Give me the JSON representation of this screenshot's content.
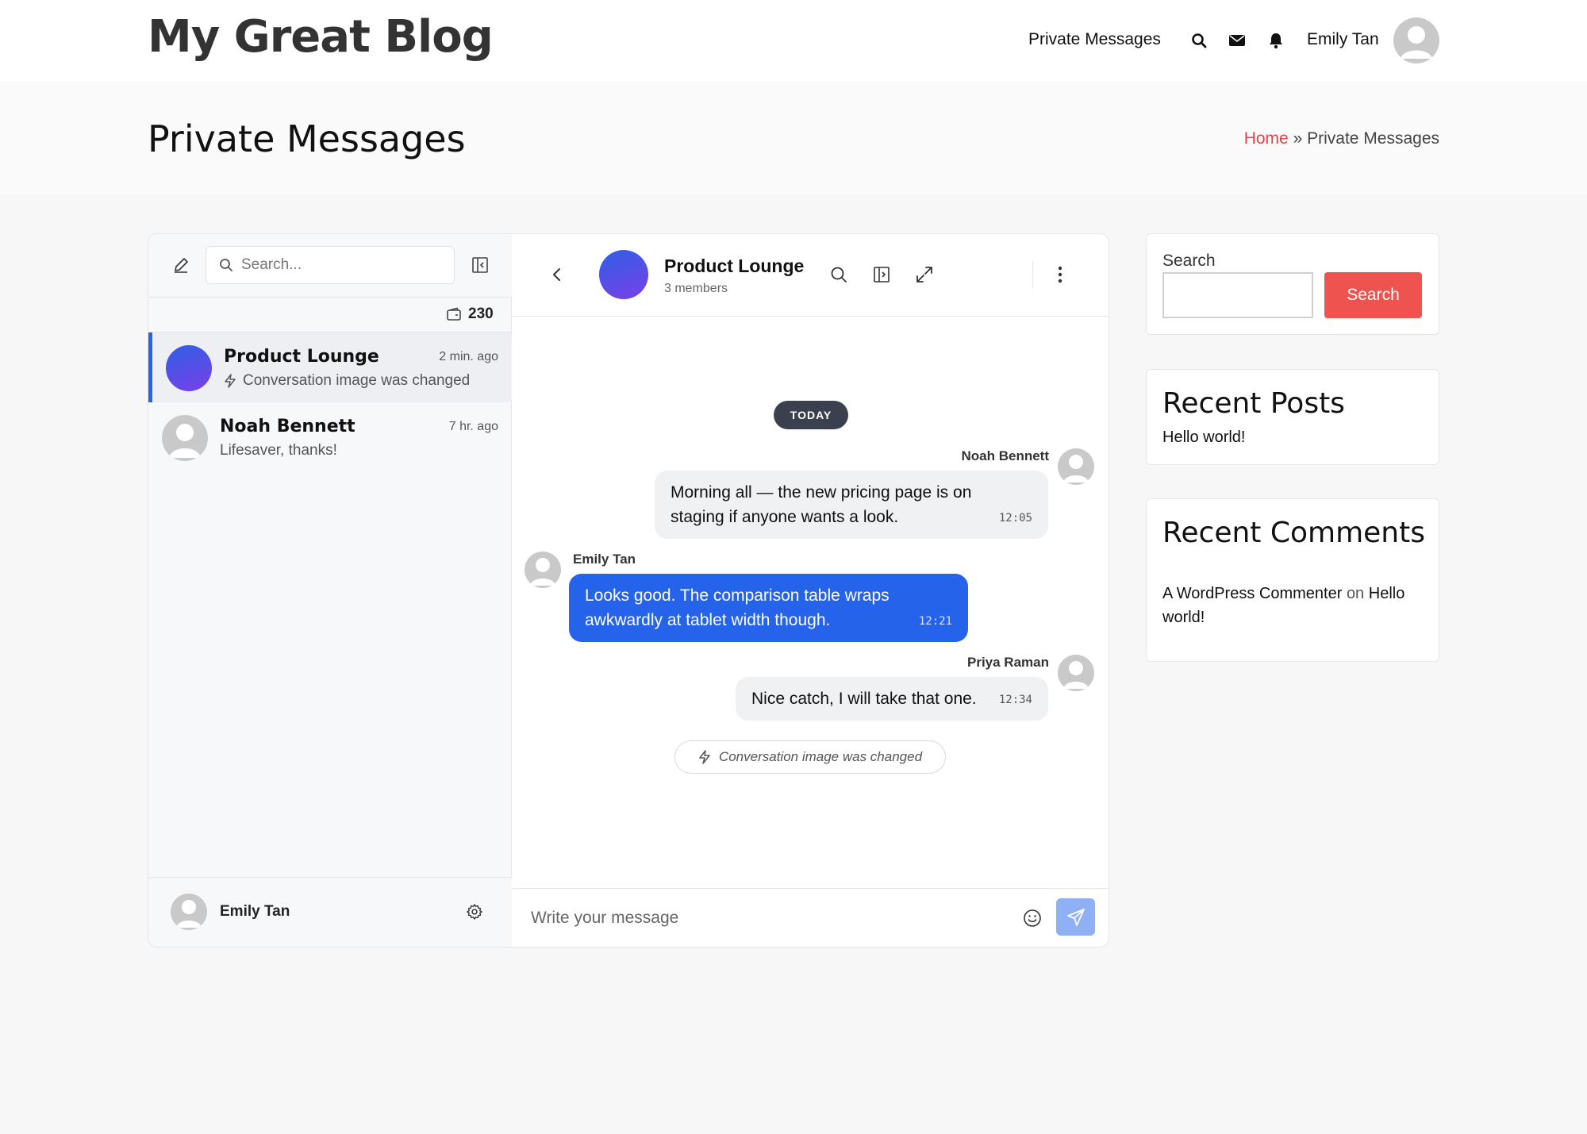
{
  "site": {
    "title": "My Great Blog",
    "nav_link": "Private Messages",
    "user_name": "Emily Tan"
  },
  "page": {
    "title": "Private Messages",
    "breadcrumb_home": "Home",
    "breadcrumb_sep": "»",
    "breadcrumb_current": "Private Messages"
  },
  "messenger": {
    "search_placeholder": "Search...",
    "count": "230",
    "conversations": [
      {
        "name": "Product Lounge",
        "time": "2 min. ago",
        "last": "Conversation image was changed",
        "active": true
      },
      {
        "name": "Noah Bennett",
        "time": "7 hr. ago",
        "last": "Lifesaver, thanks!",
        "active": false
      }
    ],
    "me": "Emily Tan",
    "chat": {
      "title": "Product Lounge",
      "subtitle": "3 members",
      "day_label": "TODAY",
      "messages": [
        {
          "sender": "Noah Bennett",
          "text_line1": "Morning all — the new pricing page is on",
          "text_line2": "staging if anyone wants a look.",
          "time": "12:05"
        },
        {
          "sender": "Emily Tan",
          "text_line1": "Looks good. The comparison table wraps",
          "text_line2": "awkwardly at tablet width though.",
          "time": "12:21"
        },
        {
          "sender": "Priya Raman",
          "text_line1": "Nice catch, I will take that one.",
          "time": "12:34"
        }
      ],
      "system_event": "Conversation image was changed",
      "composer_placeholder": "Write your message"
    },
    "colors": {
      "accent": "#2563eb",
      "send_disabled": "#8fb0f5",
      "group_avatar_from": "#2f5fe6",
      "group_avatar_to": "#7a3fe8"
    }
  },
  "sidebar": {
    "search_label": "Search",
    "search_button": "Search",
    "recent_posts_title": "Recent Posts",
    "recent_posts": [
      "Hello world!"
    ],
    "recent_comments_title": "Recent Comments",
    "comment_author": "A WordPress Commenter",
    "comment_on": "on",
    "comment_post_line1": "Hello",
    "comment_post_line2": "world!",
    "accent": "#ef5350"
  }
}
